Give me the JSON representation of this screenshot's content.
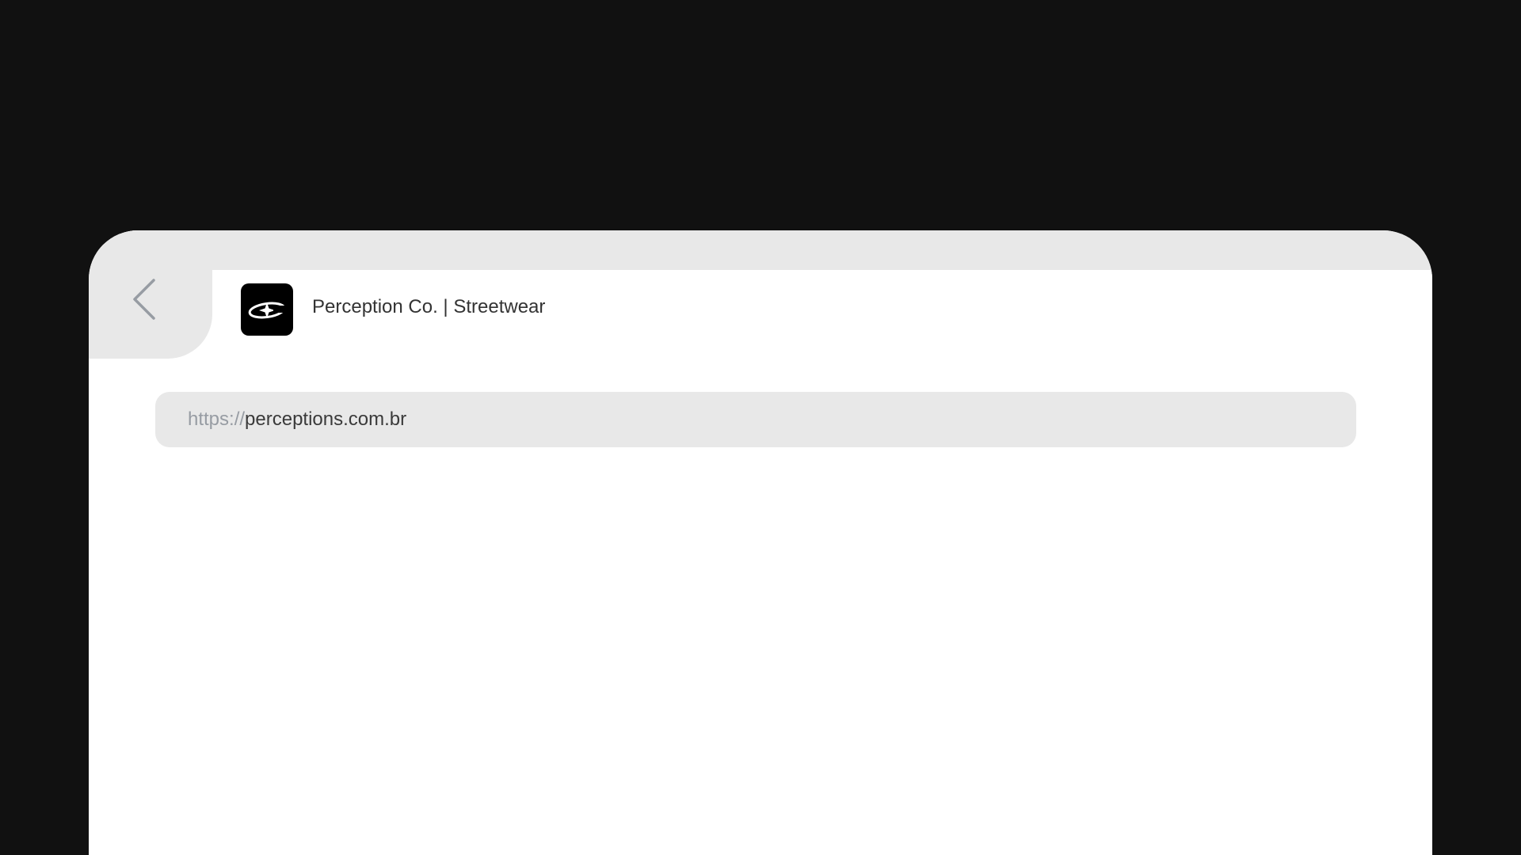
{
  "browser": {
    "back_button": {
      "icon": "chevron-left-icon"
    },
    "tab": {
      "favicon_icon": "perception-logo-icon",
      "title": "Perception Co. | Streetwear"
    },
    "address_bar": {
      "scheme": "https://",
      "host": "perceptions.com.br"
    }
  },
  "colors": {
    "background": "#111111",
    "chrome": "#e8e8e8",
    "surface": "#ffffff",
    "text": "#333333",
    "muted_text": "#979ca3"
  }
}
